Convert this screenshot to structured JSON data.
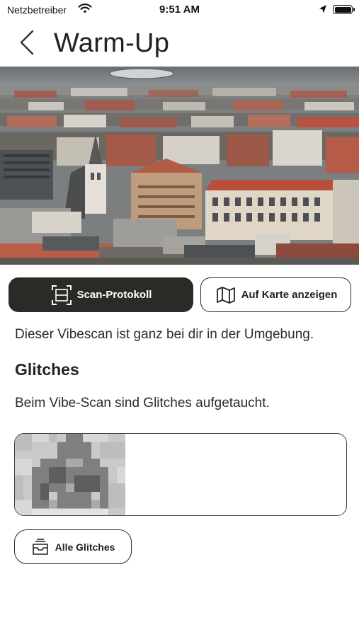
{
  "status_bar": {
    "carrier": "Netzbetreiber",
    "time": "9:51 AM"
  },
  "header": {
    "title": "Warm-Up",
    "back_icon": "chevron-left-icon"
  },
  "hero_image": {
    "subject": "aerial-city-view"
  },
  "actions": {
    "scan_protocol_label": "Scan-Protokoll",
    "scan_protocol_icon": "scan-frame-icon",
    "map_label": "Auf Karte anzeigen",
    "map_icon": "map-icon"
  },
  "description": "Dieser Vibescan ist ganz bei dir in der Umgebung.",
  "glitches": {
    "title": "Glitches",
    "text": "Beim Vibe-Scan sind Glitches aufgetaucht.",
    "all_label": "Alle Glitches",
    "all_icon": "inbox-tray-icon"
  },
  "colors": {
    "primary_dark": "#2b2a27",
    "background": "#ffffff"
  }
}
